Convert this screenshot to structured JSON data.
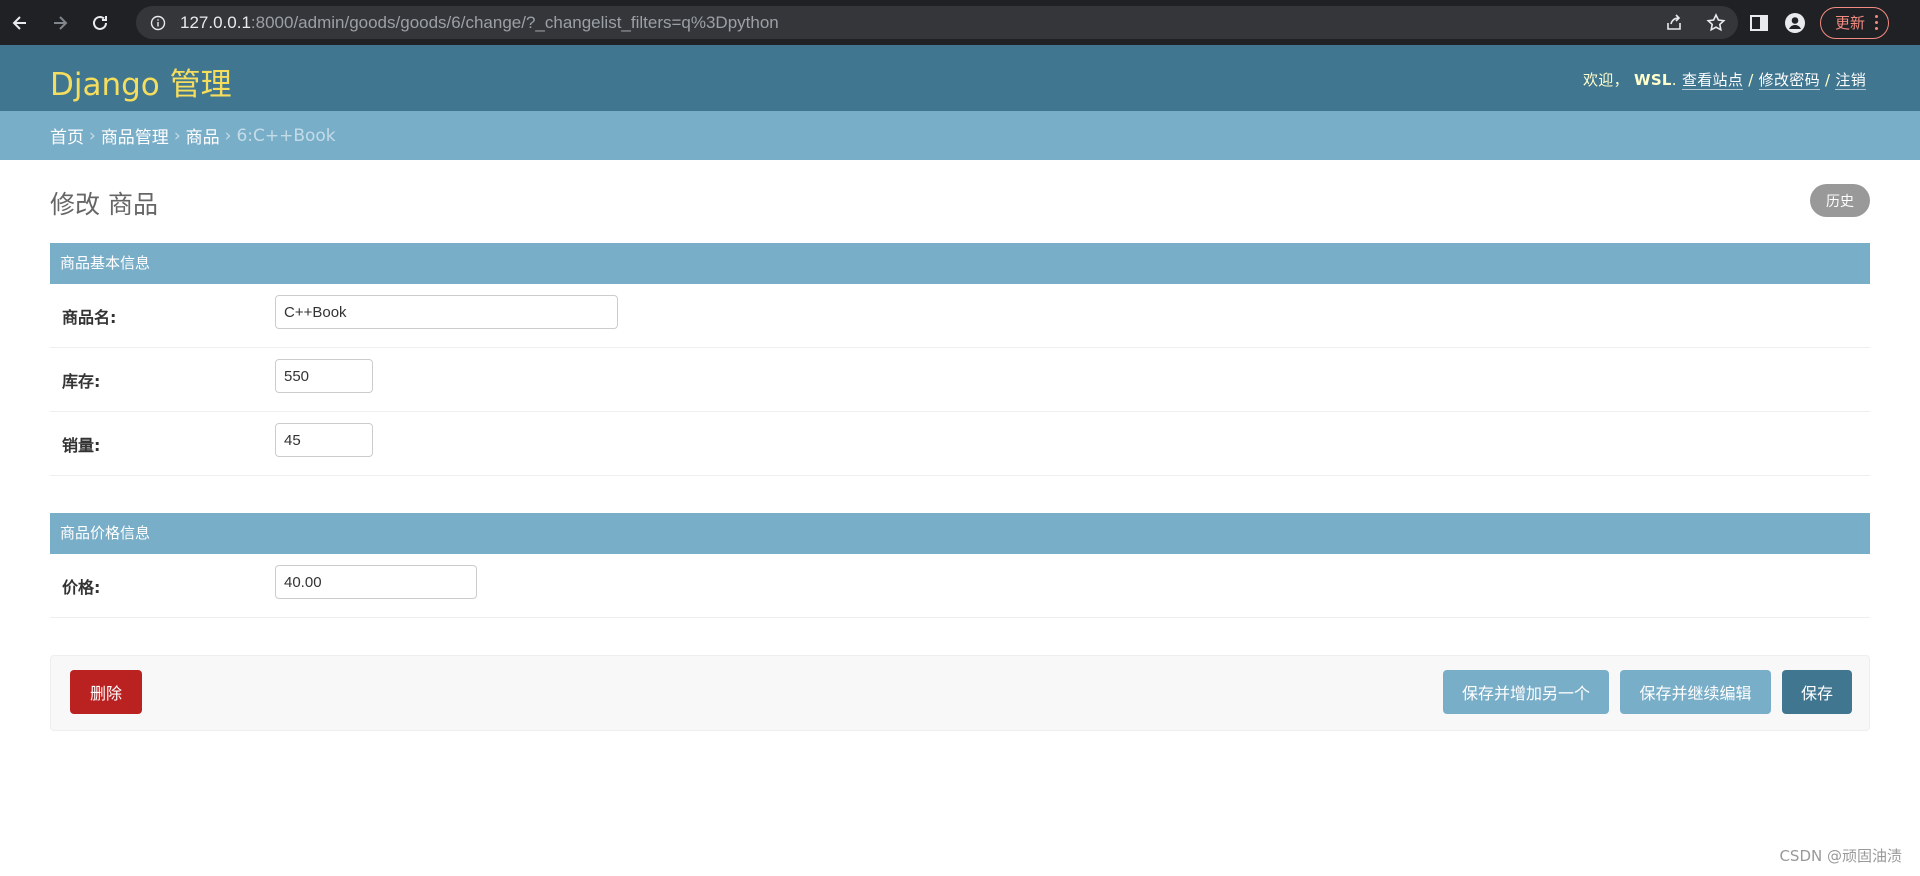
{
  "browser": {
    "url_host": "127.0.0.1",
    "url_rest": ":8000/admin/goods/goods/6/change/?_changelist_filters=q%3Dpython",
    "update_label": "更新"
  },
  "header": {
    "branding": "Django 管理",
    "welcome": "欢迎，",
    "username": "WSL",
    "view_site": "查看站点",
    "change_password": "修改密码",
    "logout": "注销",
    "sep": "/",
    "period": "."
  },
  "breadcrumbs": {
    "home": "首页",
    "app": "商品管理",
    "model": "商品",
    "current": "6:C++Book",
    "arrow": "›"
  },
  "page": {
    "title": "修改 商品",
    "history_label": "历史"
  },
  "fieldsets": {
    "basic": {
      "title": "商品基本信息",
      "name_label": "商品名:",
      "name_value": "C++Book",
      "stock_label": "库存:",
      "stock_value": "550",
      "sales_label": "销量:",
      "sales_value": "45"
    },
    "price": {
      "title": "商品价格信息",
      "price_label": "价格:",
      "price_value": "40.00"
    }
  },
  "submit_row": {
    "delete_label": "删除",
    "save_add_another_label": "保存并增加另一个",
    "save_continue_label": "保存并继续编辑",
    "save_label": "保存"
  },
  "watermark": "CSDN @顽固油渍",
  "colors": {
    "header_bg": "#417690",
    "breadcrumb_bg": "#79aec8",
    "branding": "#f5dd5d",
    "delete": "#ba2121"
  }
}
